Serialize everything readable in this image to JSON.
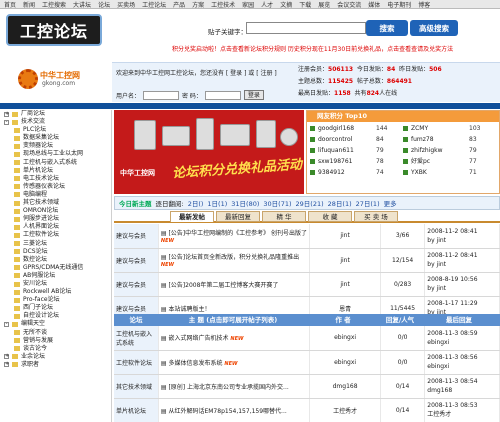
{
  "topnav": [
    "首页",
    "新闻",
    "工控搜索",
    "大讲坛",
    "论坛",
    "买卖场",
    "工控论坛",
    "产品",
    "方案",
    "工控技术",
    "家园",
    "人才",
    "文摘",
    "下载",
    "展览",
    "会议交流",
    "媒体",
    "电子期刊",
    "博客"
  ],
  "header": {
    "logo_text": "工控论坛",
    "logo2_title": "中华工控网",
    "logo2_url": "gkong.com",
    "search_label": "贴子关键字：",
    "search_value": "",
    "search_button": "搜索",
    "advanced_button": "高级搜索",
    "notice": "积分兑奖启动啦！点击查看新论坛积分规则     历史积分现在11月30日前兑换礼品，点击查看查请及兑奖方法"
  },
  "login": {
    "welcome": "欢迎来到中华工控网工控论坛，您还没有 [ 登录 ] 或 [ 注册 ]",
    "user_label": "用户名：",
    "pass_label": "密 码：",
    "login_button": "登录"
  },
  "stats": {
    "l1": "注册会员：",
    "v1": "506113",
    "l2": "今日发贴：",
    "v2": "84",
    "l3": "昨日发贴：",
    "v3": "506",
    "l4": "主题总数：",
    "v4": "115425",
    "l5": "帖子总数：",
    "v5": "864491",
    "l6": "最高日发贴：",
    "v6": "1158",
    "l7": "共有",
    "v7": "824",
    "l8": "人在线"
  },
  "sidebar": [
    {
      "label": "厂商论坛",
      "type": "top",
      "mark": "+"
    },
    {
      "label": "技术交流",
      "type": "top",
      "mark": "-"
    },
    {
      "label": "PLC论坛",
      "type": "child"
    },
    {
      "label": "数据采集论坛",
      "type": "child"
    },
    {
      "label": "变频器论坛",
      "type": "child"
    },
    {
      "label": "现场总线与工业以太网",
      "type": "child"
    },
    {
      "label": "工控机与嵌入式系统",
      "type": "child"
    },
    {
      "label": "单片机论坛",
      "type": "child"
    },
    {
      "label": "电工技术论坛",
      "type": "child"
    },
    {
      "label": "传感器仪表论坛",
      "type": "child"
    },
    {
      "label": "电脑编程",
      "type": "child"
    },
    {
      "label": "其它技术领域",
      "type": "child"
    },
    {
      "label": "OMRON论坛",
      "type": "child"
    },
    {
      "label": "伺服步进论坛",
      "type": "child"
    },
    {
      "label": "人机界面论坛",
      "type": "child"
    },
    {
      "label": "工控软件论坛",
      "type": "child"
    },
    {
      "label": "三菱论坛",
      "type": "child"
    },
    {
      "label": "DCS论坛",
      "type": "child"
    },
    {
      "label": "数控论坛",
      "type": "child"
    },
    {
      "label": "GPRS/CDMA无线通信",
      "type": "child"
    },
    {
      "label": "AB伺服论坛",
      "type": "child"
    },
    {
      "label": "安川论坛",
      "type": "child"
    },
    {
      "label": "Rockwell AB论坛",
      "type": "child"
    },
    {
      "label": "Pro-face论坛",
      "type": "child"
    },
    {
      "label": "西门子论坛",
      "type": "child"
    },
    {
      "label": "自控设计论坛",
      "type": "child"
    },
    {
      "label": "编辑天空",
      "type": "top",
      "mark": "-"
    },
    {
      "label": "无所不谈",
      "type": "child"
    },
    {
      "label": "营销与发展",
      "type": "child"
    },
    {
      "label": "谈古论今",
      "type": "child"
    },
    {
      "label": "业余论坛",
      "type": "top",
      "mark": "+"
    },
    {
      "label": "求职者",
      "type": "top",
      "mark": "+"
    }
  ],
  "banner": {
    "site": "中华工控网",
    "slogan": "论坛积分兑换礼品活动"
  },
  "top10": {
    "title": "网友积分 Top10",
    "items": [
      {
        "name": "goodgirl168",
        "count": "144"
      },
      {
        "name": "ZCMY",
        "count": "103"
      },
      {
        "name": "doorcontrol",
        "count": "84"
      },
      {
        "name": "fumz78",
        "count": "83"
      },
      {
        "name": "lifuquan611",
        "count": "79"
      },
      {
        "name": "zhifzhigkw",
        "count": "79"
      },
      {
        "name": "sxw198761",
        "count": "78"
      },
      {
        "name": "好爱pc",
        "count": "77"
      },
      {
        "name": "9384912",
        "count": "74"
      },
      {
        "name": "YXBK",
        "count": "71"
      }
    ]
  },
  "dates": {
    "today_label": "今日新主题",
    "earlier": "逐日翻阅:",
    "list": [
      "2日()",
      "1日(1)",
      "31日(80)",
      "30日(71)",
      "29日(21)",
      "28日(1)",
      "27日(1)"
    ],
    "more": "更多"
  },
  "tabs": [
    "最新发帖",
    "最新回复",
    "精 华",
    "收 藏",
    "买 卖 场"
  ],
  "posts1": [
    {
      "cat": "建议与会员",
      "title": "[公告]中华工控网编制的《工控参考》 创刊号出版了",
      "new": true,
      "author": "jint",
      "reply": "3/66",
      "time1": "2008-11-2 08:41",
      "time2": "by jint"
    },
    {
      "cat": "建议与会员",
      "title": "[公告]论坛首页全新改版，积分兑换礼品隆重推出",
      "new": true,
      "author": "jint",
      "reply": "12/154",
      "time1": "2008-11-2 08:41",
      "time2": "by jint"
    },
    {
      "cat": "建议与会员",
      "title": "[公告]2008年第二届工控博客大赛开赛了",
      "new": false,
      "author": "jint",
      "reply": "0/283",
      "time1": "2008-8-19 10:56",
      "time2": "by jint"
    },
    {
      "cat": "建议与会员",
      "title": "本站诚聘版主！",
      "new": false,
      "author": "恩青",
      "reply": "11/5445",
      "time1": "2008-1-17 11:29",
      "time2": "by jint"
    }
  ],
  "thead2": {
    "c1": "论坛",
    "c2": "主 题 (点击即可展开帖子列表)",
    "c3": "作 者",
    "c4": "回复/人气",
    "c5": "最后回复"
  },
  "posts2": [
    {
      "cat": "工控机与嵌入式系统",
      "title": "嵌入式网络广告机技术",
      "new": true,
      "author": "ebingxi",
      "reply": "0/0",
      "time1": "2008-11-3 08:59",
      "time2": "ebingxi"
    },
    {
      "cat": "工控软件论坛",
      "title": "多媒体信息发布系统",
      "new": true,
      "author": "ebingxi",
      "reply": "0/0",
      "time1": "2008-11-3 08:56",
      "time2": "ebingxi"
    },
    {
      "cat": "其它技术领域",
      "title": "[原创] 上海北京东南公司专业承揽国内外交...",
      "new": false,
      "author": "dmg168",
      "reply": "0/14",
      "time1": "2008-11-3 08:54",
      "time2": "dmg168"
    },
    {
      "cat": "单片机论坛",
      "title": "从红外解码话EM78p154,157,159哪替代...",
      "new": false,
      "author": "工控秀才",
      "reply": "0/14",
      "time1": "2008-11-3 08:53",
      "time2": "工控秀才"
    }
  ],
  "colors": {
    "blue_bar": "#0f4f9a",
    "accent_orange": "#f49b3b",
    "banner_red": "#c41a1a",
    "stat_red": "#dd0000"
  }
}
